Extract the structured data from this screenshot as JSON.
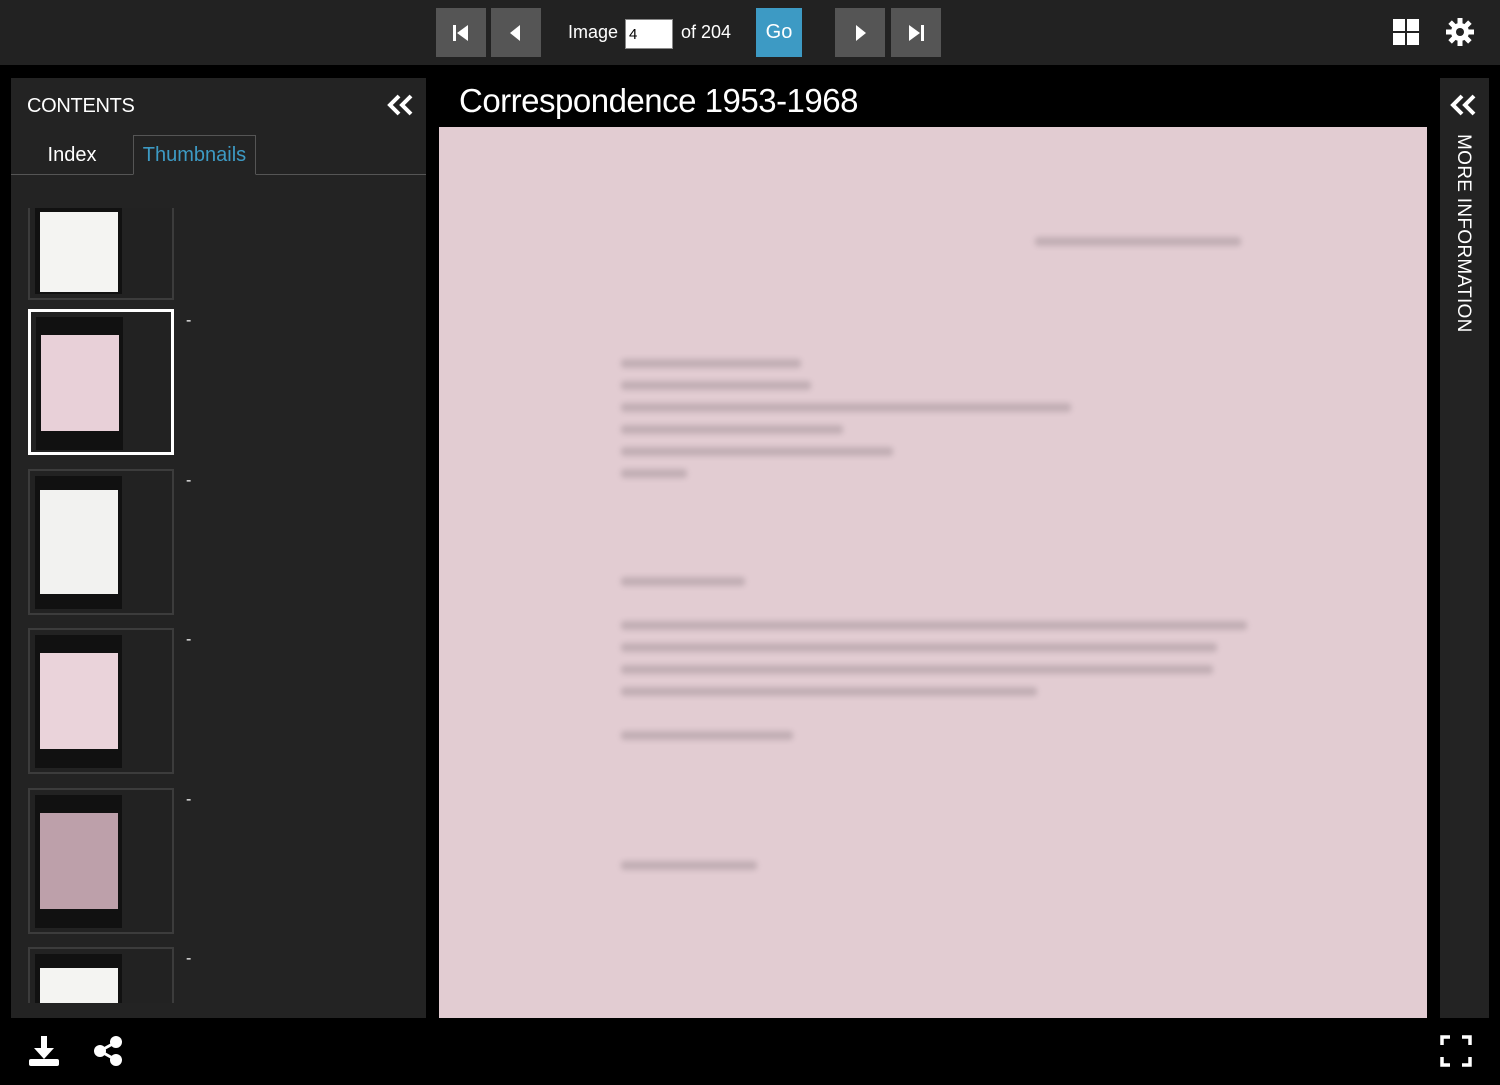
{
  "toolbar": {
    "image_label": "Image",
    "image_value": "4",
    "of_label": "of 204",
    "go_label": "Go",
    "first_icon": "skip-first-icon",
    "prev_icon": "previous-icon",
    "next_icon": "next-icon",
    "last_icon": "skip-last-icon",
    "gallery_icon": "gallery-grid-icon",
    "settings_icon": "gear-icon"
  },
  "left_panel": {
    "title": "CONTENTS",
    "tabs": [
      {
        "label": "Index",
        "active": false
      },
      {
        "label": "Thumbnails",
        "active": true
      }
    ],
    "thumbnails": [
      {
        "label": "",
        "page_color": "#f4f4f2",
        "selected": false
      },
      {
        "label": "-",
        "page_color": "#e8d0d8",
        "selected": true
      },
      {
        "label": "-",
        "page_color": "#f2f2f0",
        "selected": false
      },
      {
        "label": "-",
        "page_color": "#ead3da",
        "selected": false
      },
      {
        "label": "-",
        "page_color": "#bda0aa",
        "selected": false
      },
      {
        "label": "-",
        "page_color": "#f4f4f2",
        "selected": false
      }
    ]
  },
  "viewer": {
    "title": "Correspondence 1953-1968",
    "page_color": "#e2ccd2"
  },
  "right_panel": {
    "label": "MORE INFORMATION"
  },
  "bottom": {
    "download_icon": "download-icon",
    "share_icon": "share-icon",
    "fullscreen_icon": "fullscreen-icon"
  },
  "colors": {
    "accent": "#3d9ac4",
    "panel": "#232323",
    "button": "#555555"
  }
}
